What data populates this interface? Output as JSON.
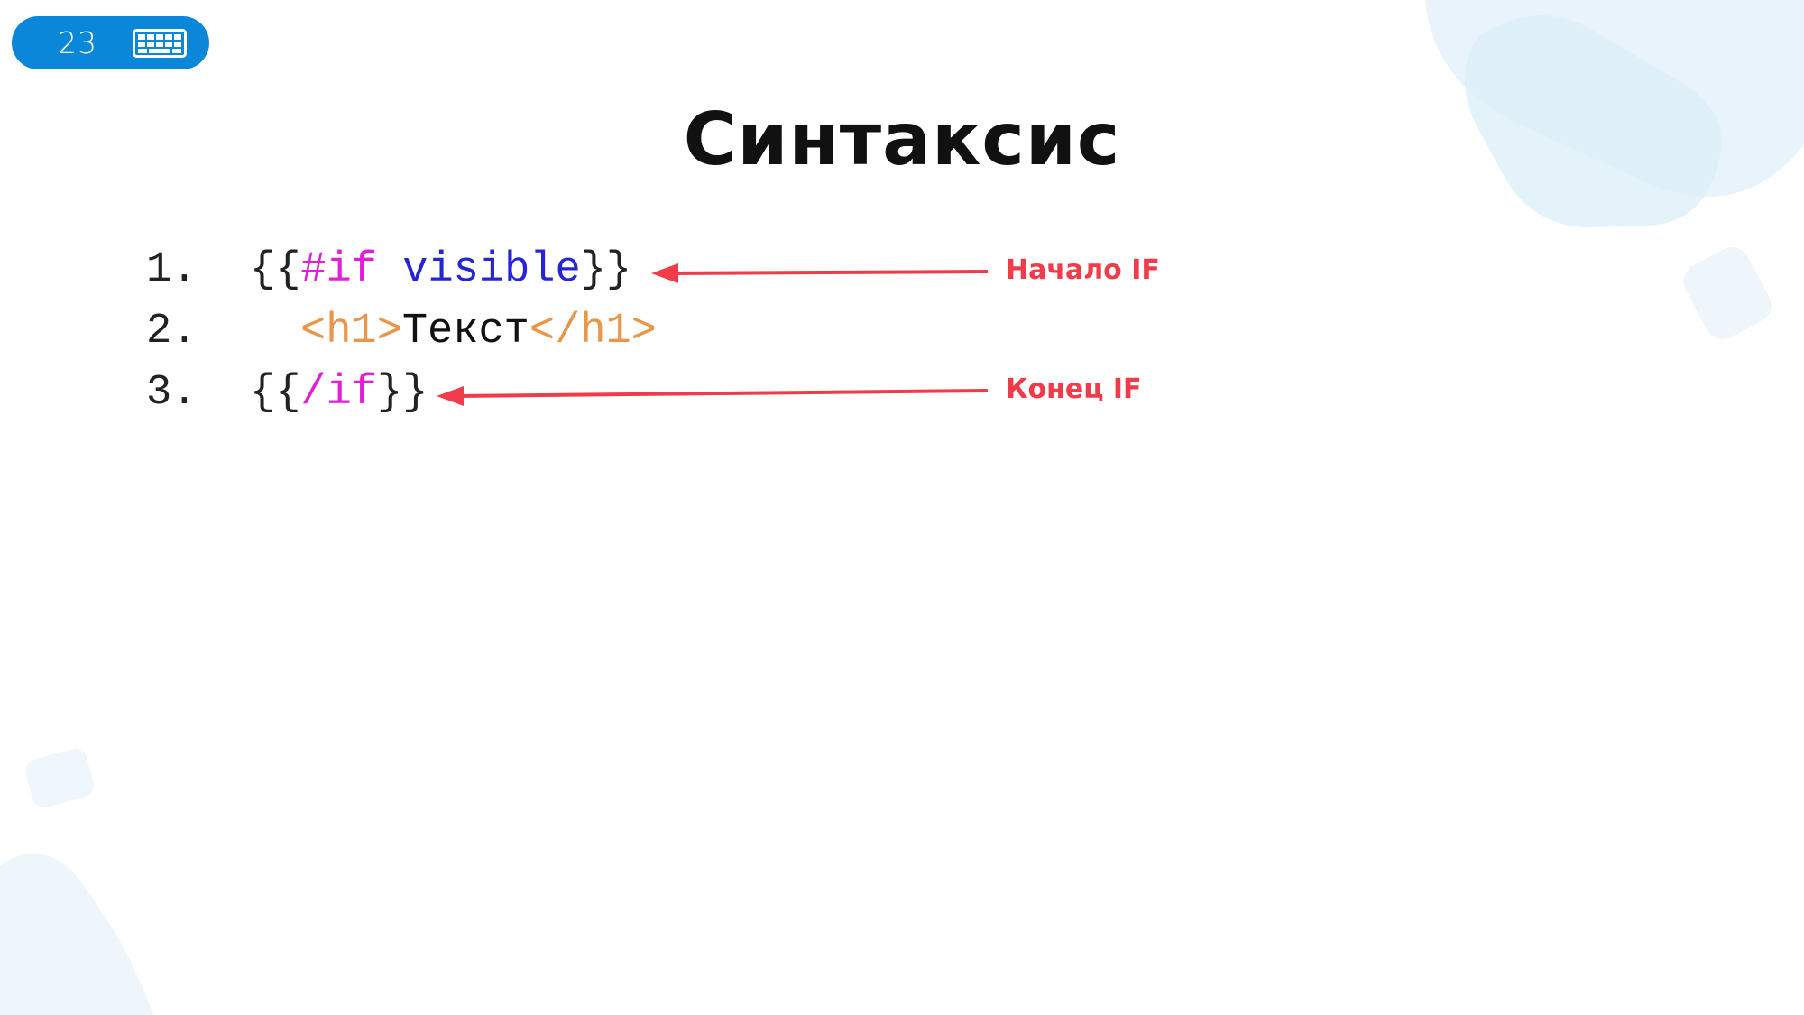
{
  "slide": {
    "number": "23",
    "badge_icon": "keyboard-icon",
    "title": "Синтаксис"
  },
  "code": {
    "lines": [
      {
        "number": "1.",
        "open": "{{",
        "keyword": "#if",
        "space": " ",
        "variable": "visible",
        "close": "}}"
      },
      {
        "number": "2.",
        "tag_open": "<h1>",
        "text": "Текст",
        "tag_close": "</h1>"
      },
      {
        "number": "3.",
        "open": "{{",
        "keyword": "/if",
        "close": "}}"
      }
    ]
  },
  "annotations": {
    "start": "Начало IF",
    "end": "Конец IF"
  },
  "colors": {
    "badge": "#0b87d9",
    "keyword": "#e020d8",
    "variable": "#2525d6",
    "tag": "#e8974a",
    "annotation": "#f03c4a"
  }
}
